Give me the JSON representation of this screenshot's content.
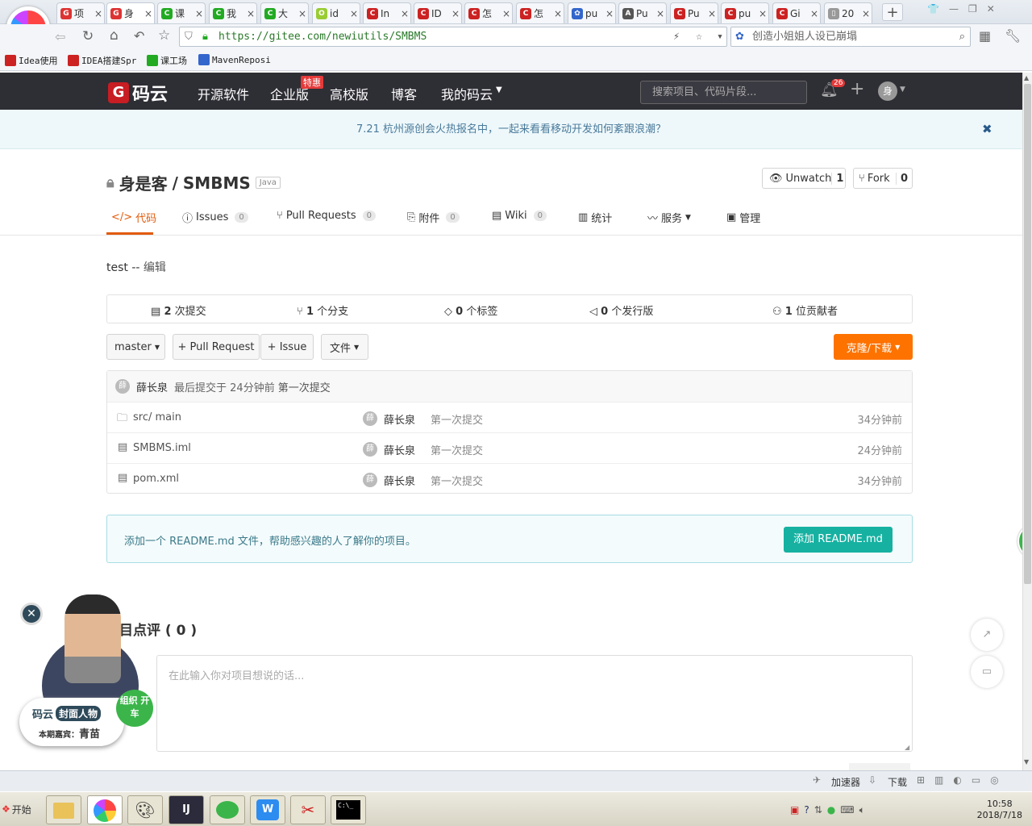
{
  "browser": {
    "tabs": [
      {
        "label": "项",
        "icon": "G",
        "color": "#d33"
      },
      {
        "label": "身",
        "icon": "G",
        "color": "#d33",
        "active": true
      },
      {
        "label": "课",
        "icon": "C",
        "color": "#2a2"
      },
      {
        "label": "我",
        "icon": "C",
        "color": "#2a2"
      },
      {
        "label": "大",
        "icon": "C",
        "color": "#2a2"
      },
      {
        "label": "id",
        "icon": "O",
        "color": "#9c3"
      },
      {
        "label": "In",
        "icon": "C",
        "color": "#c22"
      },
      {
        "label": "ID",
        "icon": "C",
        "color": "#c22"
      },
      {
        "label": "怎",
        "icon": "C",
        "color": "#c22"
      },
      {
        "label": "怎",
        "icon": "C",
        "color": "#c22"
      },
      {
        "label": "pu",
        "icon": "✿",
        "color": "#36c"
      },
      {
        "label": "Pu",
        "icon": "A",
        "color": "#555"
      },
      {
        "label": "Pu",
        "icon": "C",
        "color": "#c22"
      },
      {
        "label": "pu",
        "icon": "C",
        "color": "#c22"
      },
      {
        "label": "Gi",
        "icon": "C",
        "color": "#c22"
      },
      {
        "label": "20",
        "icon": "▯",
        "color": "#999"
      }
    ],
    "new_tab": "+",
    "url": "https://gitee.com/newiutils/SMBMS",
    "search_text": "创造小姐姐人设已崩塌",
    "bookmarks": [
      {
        "label": "Idea使用",
        "color": "#c22"
      },
      {
        "label": "IDEA搭建Spr",
        "color": "#c22"
      },
      {
        "label": "课工场",
        "color": "#2a2"
      },
      {
        "label": "MavenReposi",
        "color": "#36c"
      }
    ]
  },
  "site": {
    "logo": "码云",
    "nav": [
      "开源软件",
      "企业版",
      "高校版",
      "博客",
      "我的码云"
    ],
    "promo_badge": "特惠",
    "search_placeholder": "搜索项目、代码片段...",
    "notif_count": "26",
    "avatar_text": "身",
    "banner": "7.21 杭州源创会火热报名中，一起来看看移动开发如何紊跟浪潮？"
  },
  "repo": {
    "owner": "身是客",
    "name": "SMBMS",
    "lang": "Java",
    "unwatch_label": "Unwatch",
    "unwatch_count": "1",
    "fork_label": "Fork",
    "fork_count": "0",
    "tabs": [
      {
        "label": "代码"
      },
      {
        "label": "Issues",
        "count": "0"
      },
      {
        "label": "Pull Requests",
        "count": "0"
      },
      {
        "label": "附件",
        "count": "0"
      },
      {
        "label": "Wiki",
        "count": "0"
      },
      {
        "label": "统计"
      },
      {
        "label": "服务"
      },
      {
        "label": "管理"
      }
    ],
    "description": "test",
    "edit_link": "编辑",
    "stats": [
      {
        "num": "2",
        "label": "次提交"
      },
      {
        "num": "1",
        "label": "个分支"
      },
      {
        "num": "0",
        "label": "个标签"
      },
      {
        "num": "0",
        "label": "个发行版"
      },
      {
        "num": "1",
        "label": "位贡献者"
      }
    ],
    "branch": "master",
    "pr_btn": "+ Pull Request",
    "issue_btn": "+ Issue",
    "file_btn": "文件",
    "clone_btn": "克隆/下载",
    "last_commit": {
      "author": "薛长泉",
      "text": "最后提交于 24分钟前",
      "message": "第一次提交"
    },
    "files": [
      {
        "name": "src/ main",
        "author": "薛长泉",
        "message": "第一次提交",
        "time": "34分钟前"
      },
      {
        "name": "SMBMS.iml",
        "author": "薛长泉",
        "message": "第一次提交",
        "time": "24分钟前"
      },
      {
        "name": "pom.xml",
        "author": "薛长泉",
        "message": "第一次提交",
        "time": "34分钟前"
      }
    ],
    "readme_text": "添加一个 README.md 文件，帮助感兴趣的人了解你的项目。",
    "readme_btn": "添加 README.md",
    "reviews_title": "目点评 ( 0 )",
    "comment_placeholder": "在此输入你对项目想说的话..."
  },
  "ad": {
    "brand": "码云",
    "series": "封面人物",
    "bubble": "组织 开车",
    "guest_label": "本期嘉宾：",
    "guest": "青苗"
  },
  "side_badge": "65",
  "statusbar": {
    "accelerator": "加速器",
    "download": "下载"
  },
  "taskbar": {
    "start": "开始",
    "time": "10:58",
    "date": "2018/7/18"
  }
}
